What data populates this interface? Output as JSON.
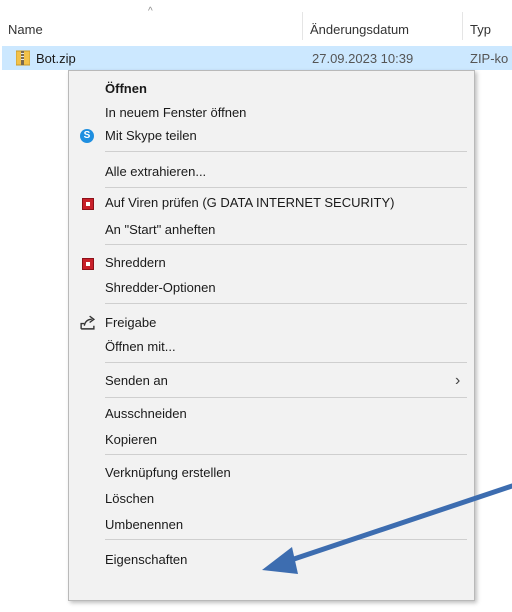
{
  "header": {
    "col_name": "Name",
    "col_date": "Änderungsdatum",
    "col_type": "Typ",
    "sort_indicator": "^"
  },
  "file": {
    "name": "Bot.zip",
    "date": "27.09.2023 10:39",
    "type": "ZIP-ko",
    "icon": "zip-folder-icon"
  },
  "menu": {
    "open": "Öffnen",
    "open_new_window": "In neuem Fenster öffnen",
    "skype_share": "Mit Skype teilen",
    "skype_icon_letter": "S",
    "extract_all": "Alle extrahieren...",
    "virus_scan": "Auf Viren prüfen (G DATA INTERNET SECURITY)",
    "pin_start": "An \"Start\" anheften",
    "shred": "Shreddern",
    "shredder_options": "Shredder-Optionen",
    "share": "Freigabe",
    "open_with": "Öffnen mit...",
    "send_to": "Senden an",
    "send_to_arrow": "›",
    "cut": "Ausschneiden",
    "copy": "Kopieren",
    "create_shortcut": "Verknüpfung erstellen",
    "delete": "Löschen",
    "rename": "Umbenennen",
    "properties": "Eigenschaften"
  },
  "colors": {
    "selection": "#cce8ff",
    "menu_bg": "#f2f2f2",
    "annotation_arrow": "#3d6db0",
    "gdata_red": "#c8202a",
    "skype_blue": "#1f8fe0"
  },
  "icons": [
    "zip-folder-icon",
    "skype-icon",
    "gdata-icon",
    "shredder-icon",
    "share-icon",
    "chevron-right-icon",
    "annotation-arrow"
  ]
}
